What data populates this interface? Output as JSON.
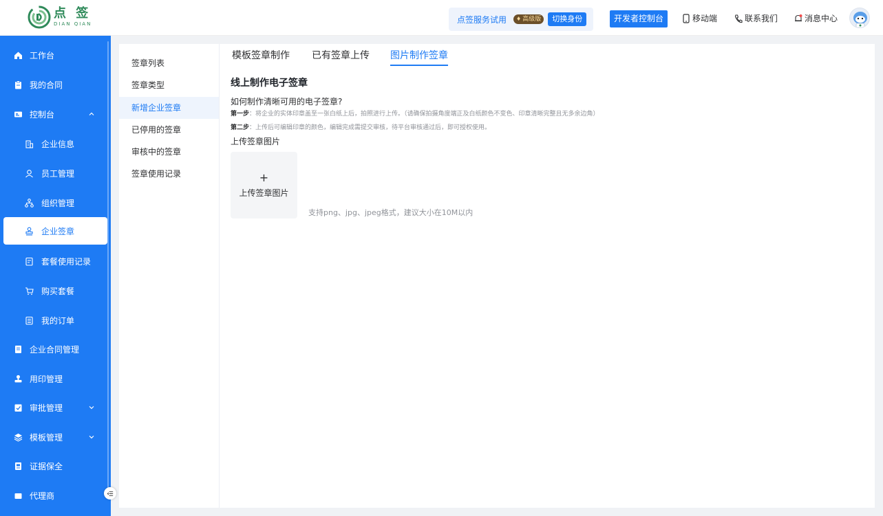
{
  "header": {
    "logo_cn": "点 签",
    "logo_en": "DIAN QIAN",
    "trial_text": "点签服务试用",
    "vip_badge": "高级版",
    "switch_identity": "切换身份",
    "developer_console": "开发者控制台",
    "mobile": "移动端",
    "contact": "联系我们",
    "messages": "消息中心"
  },
  "sidebar": {
    "items": [
      {
        "label": "工作台"
      },
      {
        "label": "我的合同"
      },
      {
        "label": "控制台"
      },
      {
        "label": "企业信息"
      },
      {
        "label": "员工管理"
      },
      {
        "label": "组织管理"
      },
      {
        "label": "企业签章"
      },
      {
        "label": "套餐使用记录"
      },
      {
        "label": "购买套餐"
      },
      {
        "label": "我的订单"
      },
      {
        "label": "企业合同管理"
      },
      {
        "label": "用印管理"
      },
      {
        "label": "审批管理"
      },
      {
        "label": "模板管理"
      },
      {
        "label": "证据保全"
      },
      {
        "label": "代理商"
      }
    ]
  },
  "subnav": {
    "items": [
      {
        "label": "签章列表"
      },
      {
        "label": "签章类型"
      },
      {
        "label": "新增企业签章"
      },
      {
        "label": "已停用的签章"
      },
      {
        "label": "审核中的签章"
      },
      {
        "label": "签章使用记录"
      }
    ]
  },
  "tabs": [
    {
      "label": "模板签章制作"
    },
    {
      "label": "已有签章上传"
    },
    {
      "label": "图片制作签章"
    }
  ],
  "content": {
    "title": "线上制作电子签章",
    "question": "如何制作清晰可用的电子签章?",
    "step1_label": "第一步",
    "step1_text": "：将企业的实体印章盖至一张白纸上后，拍照进行上传。（请确保拍摄角度端正及白纸颜色不变色、印章清晰完整且无多余边角）",
    "step2_label": "第二步",
    "step2_text": "：上传后可编辑印章的颜色，编辑完成需提交审核，待平台审核通过后，即可授权使用。",
    "upload_label": "上传签章图片",
    "upload_plus": "+",
    "upload_button": "上传签章图片",
    "upload_hint": "支持png、jpg、jpeg格式，建议大小在10M以内"
  },
  "colors": {
    "primary": "#1e7bf4",
    "logo_green": "#2f8a5a",
    "muted": "#909399"
  }
}
